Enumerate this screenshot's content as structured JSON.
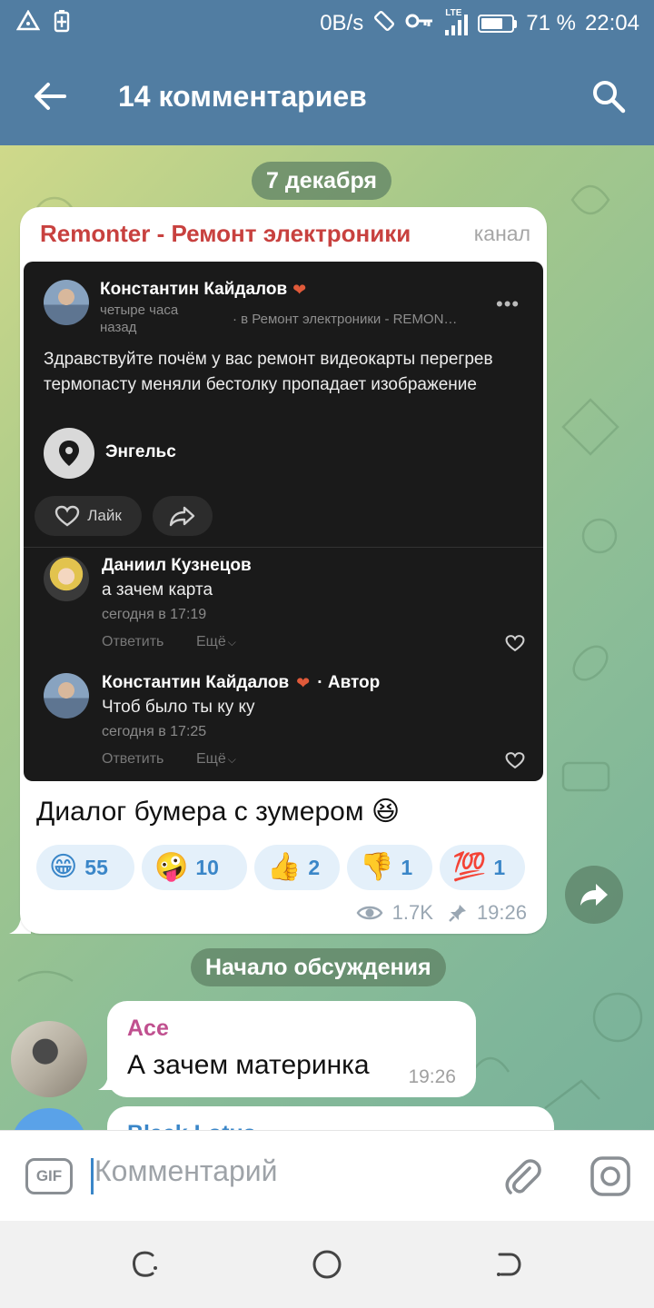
{
  "status_bar": {
    "speed": "0B/s",
    "network": "LTE",
    "battery": "71 %",
    "battery_level": 0.71,
    "time": "22:04"
  },
  "header": {
    "title": "14 комментариев",
    "back_icon": "arrow-left-icon",
    "search_icon": "search-icon"
  },
  "chat": {
    "date_pill": "7 декабря",
    "post": {
      "channel": "Remonter - Ремонт электроники",
      "tag": "канал",
      "screenshot": {
        "author": "Константин Кайдалов",
        "time": "четыре часа назад",
        "group": "· в Ремонт электроники - REMON…",
        "text": "Здравствуйте почём у вас ремонт видеокарты перегрев термопасту меняли бестолку пропадает изображение",
        "location": "Энгельс",
        "like_label": "Лайк",
        "comments": [
          {
            "author": "Даниил Кузнецов",
            "author_suffix": "",
            "text": "а зачем карта",
            "time": "сегодня в 17:19",
            "reply": "Ответить",
            "more": "Ещё"
          },
          {
            "author": "Константин Кайдалов",
            "author_suffix": "· Автор",
            "text": "Чтоб было ты ку ку",
            "time": "сегодня в 17:25",
            "reply": "Ответить",
            "more": "Ещё"
          }
        ]
      },
      "caption": "Диалог бумера с зумером 😆",
      "reactions": [
        {
          "emoji": "😁",
          "count": "55"
        },
        {
          "emoji": "🤪",
          "count": "10"
        },
        {
          "emoji": "👍",
          "count": "2"
        },
        {
          "emoji": "👎",
          "count": "1"
        },
        {
          "emoji": "💯",
          "count": "1"
        }
      ],
      "views": "1.7K",
      "time": "19:26"
    },
    "discussion_pill": "Начало обсуждения",
    "messages": [
      {
        "author": "Ace",
        "author_color": "#c0508f",
        "text": "А зачем материнка",
        "time": "19:26"
      },
      {
        "author": "Black Lotus",
        "author_color": "#3a86c8",
        "text": "",
        "time": ""
      }
    ]
  },
  "input": {
    "gif_label": "GIF",
    "placeholder": "Комментарий",
    "attach_icon": "paperclip-icon",
    "camera_icon": "camera-icon"
  },
  "colors": {
    "header": "#517da2",
    "channel_name": "#c8413f",
    "reaction_bg": "#e4f0fa",
    "reaction_text": "#3a86c8"
  }
}
